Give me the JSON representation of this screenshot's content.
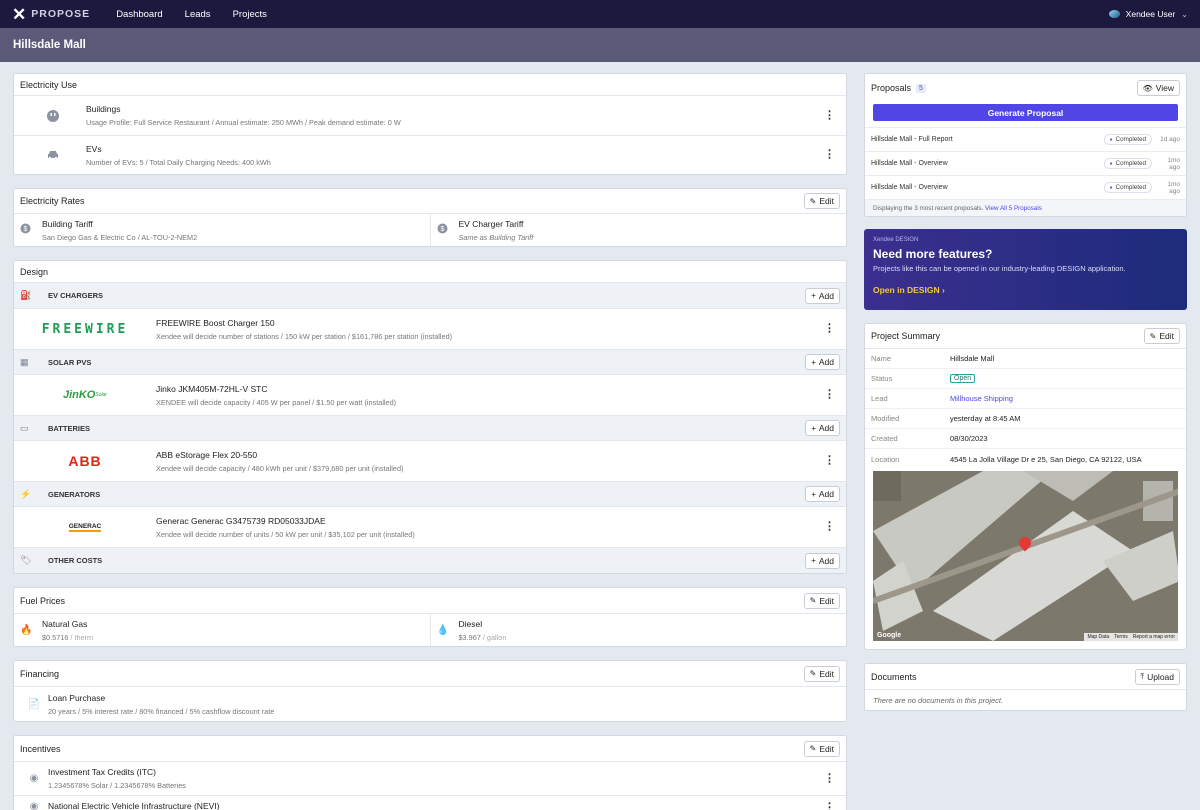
{
  "nav": {
    "brand": "PROPOSE",
    "links": [
      "Dashboard",
      "Leads",
      "Projects"
    ],
    "user": "Xendee User"
  },
  "title": "Hillsdale Mall",
  "electricity_use": {
    "title": "Electricity Use",
    "buildings": {
      "label": "Buildings",
      "detail": "Usage Profile: Full Service Restaurant  /  Annual estimate: 250 MWh  /  Peak demand estimate: 0 W"
    },
    "evs": {
      "label": "EVs",
      "detail": "Number of EVs: 5  /  Total Daily Charging Needs: 400 kWh"
    }
  },
  "electricity_rates": {
    "title": "Electricity Rates",
    "edit": "Edit",
    "building": {
      "label": "Building Tariff",
      "detail": "San Diego Gas & Electric Co / AL-TOU-2-NEM2"
    },
    "ev": {
      "label": "EV Charger Tariff",
      "detail": "Same as Building Tariff"
    }
  },
  "design": {
    "title": "Design",
    "add": "Add",
    "ev_chargers": {
      "title": "EV CHARGERS",
      "logo": "FREEWIRE",
      "name": "FREEWIRE Boost Charger 150",
      "detail": "Xendee will decide number of stations  /  150 kW per station  /  $161,786 per station (installed)"
    },
    "solar": {
      "title": "SOLAR PVS",
      "logo": "JinKO",
      "logo_sub": "Solar",
      "name": "Jinko JKM405M-72HL-V STC",
      "detail": "XENDEE will decide capacity  /  405 W per panel  /  $1.50 per watt (installed)"
    },
    "batteries": {
      "title": "BATTERIES",
      "logo": "ABB",
      "name": "ABB eStorage Flex 20-550",
      "detail": "Xendee will decide capacity  /  480 kWh per unit  /  $379,680 per unit (installed)"
    },
    "generators": {
      "title": "GENERATORS",
      "logo": "GENERAC",
      "name": "Generac Generac G3475739 RD05033JDAE",
      "detail": "Xendee will decide number of units  /  50 kW per unit  /  $35,102 per unit (installed)"
    },
    "other": {
      "title": "OTHER COSTS"
    }
  },
  "fuel": {
    "title": "Fuel Prices",
    "edit": "Edit",
    "gas": {
      "label": "Natural Gas",
      "value": "$0.5716",
      "unit": " / therm"
    },
    "diesel": {
      "label": "Diesel",
      "value": "$3.967",
      "unit": " / gallon"
    }
  },
  "financing": {
    "title": "Financing",
    "edit": "Edit",
    "label": "Loan Purchase",
    "detail": "20 years  /  5% interest rate  /  80% financed  /  5% cashflow discount rate"
  },
  "incentives": {
    "title": "Incentives",
    "edit": "Edit",
    "itc": {
      "label": "Investment Tax Credits (ITC)",
      "detail": "1.2345678% Solar  /  1.2345678% Batteries"
    },
    "nevi": {
      "label": "National Electric Vehicle Infrastructure (NEVI)"
    }
  },
  "proposals": {
    "title": "Proposals",
    "count": "5",
    "view": "View",
    "generate": "Generate Proposal",
    "rows": [
      {
        "name": "Hillsdale Mall - Full Report",
        "status": "Completed",
        "ago": "1d ago"
      },
      {
        "name": "Hillsdale Mall - Overview",
        "status": "Completed",
        "ago": "1mo ago"
      },
      {
        "name": "Hillsdale Mall - Overview",
        "status": "Completed",
        "ago": "1mo ago"
      }
    ],
    "footer": "Displaying the 3 most recent proposals.",
    "footer_link": "View All 5 Proposals"
  },
  "promo": {
    "kicker": "Xendee DESIGN",
    "headline": "Need more features?",
    "body": "Projects like this can be opened in our industry-leading DESIGN application.",
    "cta": "Open in DESIGN"
  },
  "summary": {
    "title": "Project Summary",
    "edit": "Edit",
    "fields": [
      {
        "k": "Name",
        "v": "Hillsdale Mall"
      },
      {
        "k": "Status",
        "v": "Open"
      },
      {
        "k": "Lead",
        "v": "Millhouse Shipping"
      },
      {
        "k": "Modified",
        "v": "yesterday at 8:45 AM"
      },
      {
        "k": "Created",
        "v": "08/30/2023"
      },
      {
        "k": "Location",
        "v": "4545 La Jolla Village Dr e 25, San Diego, CA 92122, USA"
      }
    ],
    "map": {
      "google": "Google",
      "map_data": "Map Data",
      "terms": "Terms",
      "report": "Report a map error"
    }
  },
  "documents": {
    "title": "Documents",
    "upload": "Upload",
    "empty": "There are no documents in this project."
  },
  "colors": {
    "nav_bg": "#1b1a3e",
    "title_bg": "#5a5a78",
    "accent": "#4f46e5",
    "promo_start": "#3b2f8f",
    "promo_end": "#1d2c7a",
    "cta": "#f5c842",
    "freewire": "#1f9d55",
    "abb": "#e2231a",
    "jinko": "#2d9e3f"
  }
}
